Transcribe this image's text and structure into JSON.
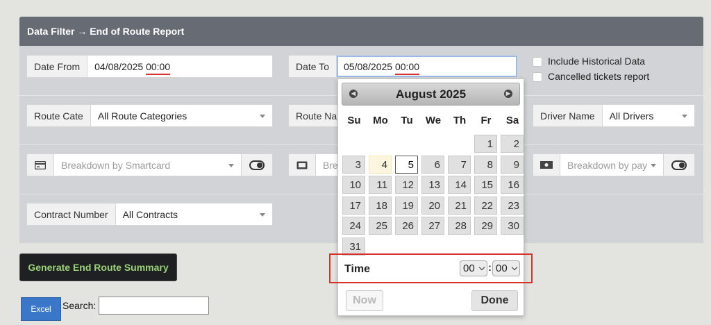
{
  "panel": {
    "title": "Data Filter → End of Route Report"
  },
  "filters": {
    "date_from": {
      "label": "Date From",
      "date": "04/08/2025",
      "time": "00:00"
    },
    "date_to": {
      "label": "Date To",
      "date": "05/08/2025",
      "time": "00:00"
    },
    "include_historical": {
      "label": "Include Historical Data",
      "checked": false
    },
    "cancelled_tickets": {
      "label": "Cancelled tickets report",
      "checked": false
    },
    "route_category": {
      "label": "Route Cate",
      "value": "All Route Categories"
    },
    "route_name": {
      "label": "Route Na"
    },
    "driver_name": {
      "label": "Driver Name",
      "value": "All Drivers"
    },
    "smartcard": {
      "placeholder": "Breakdown by Smartcard",
      "icon": "credit-card-icon"
    },
    "ticket": {
      "placeholder": "Bre",
      "icon": "ticket-icon"
    },
    "payment": {
      "placeholder": "Breakdown by pay",
      "icon": "cash-icon"
    },
    "contract_number": {
      "label": "Contract Number",
      "value": "All Contracts"
    }
  },
  "actions": {
    "generate": "Generate End Route Summary",
    "excel": "Excel",
    "search_label": "Search:",
    "search_value": ""
  },
  "datepicker": {
    "month_label": "August 2025",
    "weekdays": [
      "Su",
      "Mo",
      "Tu",
      "We",
      "Th",
      "Fr",
      "Sa"
    ],
    "first_weekday_index": 5,
    "days_in_month": 31,
    "today": 4,
    "selected": 5,
    "time_label": "Time",
    "hour": "00",
    "minute": "00",
    "time_separator": ":",
    "now_label": "Now",
    "done_label": "Done"
  },
  "colors": {
    "header_bg": "#666b74",
    "highlight_red": "#d6312a",
    "generate_text": "#9bd37a",
    "excel_bg": "#3b77c9"
  }
}
